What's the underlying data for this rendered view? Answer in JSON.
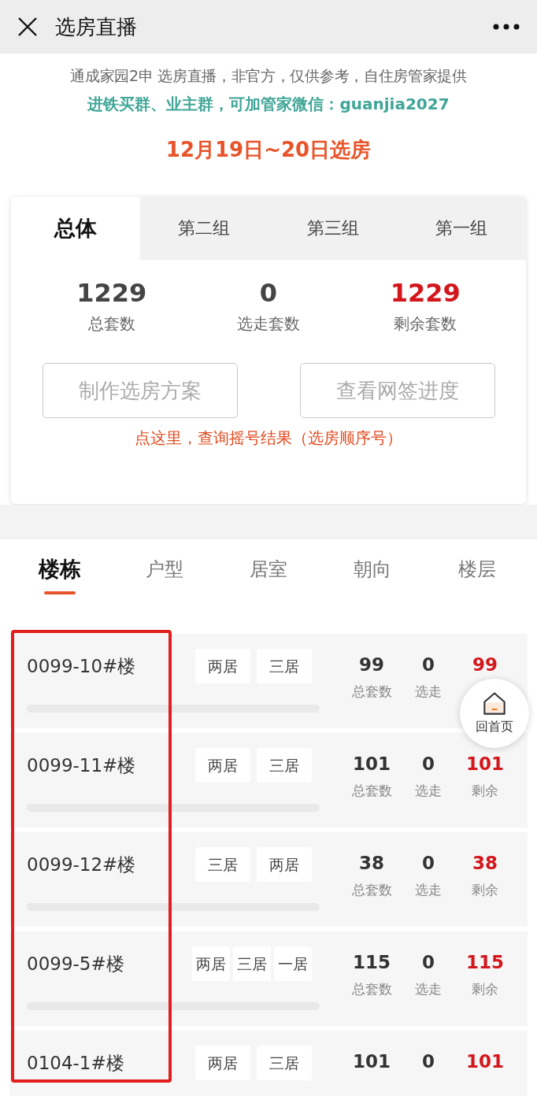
{
  "header": {
    "title": "选房直播"
  },
  "notice": {
    "line1": "通成家园2申 选房直播，非官方，仅供参考，自住房管家提供",
    "line2": "进铁买群、业主群，可加管家微信：guanjia2027",
    "date": "12月19日~20日选房"
  },
  "summary": {
    "tabs": [
      {
        "label": "总体",
        "selected": true
      },
      {
        "label": "第二组",
        "selected": false
      },
      {
        "label": "第三组",
        "selected": false
      },
      {
        "label": "第一组",
        "selected": false
      }
    ],
    "stats": [
      {
        "value": "1229",
        "label": "总套数",
        "kind": "plain"
      },
      {
        "value": "0",
        "label": "选走套数",
        "kind": "plain"
      },
      {
        "value": "1229",
        "label": "剩余套数",
        "kind": "highlight"
      }
    ],
    "buttons": [
      "制作选房方案",
      "查看网签进度"
    ],
    "link": "点这里，查询摇号结果（选房顺序号）"
  },
  "filters": [
    {
      "label": "楼栋",
      "selected": true
    },
    {
      "label": "户型",
      "selected": false
    },
    {
      "label": "居室",
      "selected": false
    },
    {
      "label": "朝向",
      "selected": false
    },
    {
      "label": "楼层",
      "selected": false
    }
  ],
  "buildings": [
    {
      "name": "0099-10#楼",
      "tags": [
        "两居",
        "三居"
      ],
      "level": 0,
      "total": {
        "value": "99",
        "label": "总套数"
      },
      "taken": {
        "value": "0",
        "label": "选走"
      },
      "remaining": {
        "value": "99"
      }
    },
    {
      "name": "0099-11#楼",
      "tags": [
        "两居",
        "三居"
      ],
      "level": 0,
      "total": {
        "value": "101",
        "label": "总套数"
      },
      "taken": {
        "value": "0",
        "label": "选走"
      },
      "remaining": {
        "value": "101",
        "label": "剩余"
      }
    },
    {
      "name": "0099-12#楼",
      "tags": [
        "三居",
        "两居"
      ],
      "level": 0,
      "total": {
        "value": "38",
        "label": "总套数"
      },
      "taken": {
        "value": "0",
        "label": "选走"
      },
      "remaining": {
        "value": "38",
        "label": "剩余"
      }
    },
    {
      "name": "0099-5#楼",
      "tags": [
        "两居",
        "三居",
        "一居"
      ],
      "level": 0,
      "total": {
        "value": "115",
        "label": "总套数"
      },
      "taken": {
        "value": "0",
        "label": "选走"
      },
      "remaining": {
        "value": "115",
        "label": "剩余"
      }
    },
    {
      "name": "0104-1#楼",
      "tags": [
        "两居",
        "三居"
      ],
      "total": {
        "value": "101"
      },
      "taken": {
        "value": "0"
      },
      "remaining": {
        "value": "101"
      }
    }
  ],
  "home_button": {
    "label": "回首页"
  }
}
